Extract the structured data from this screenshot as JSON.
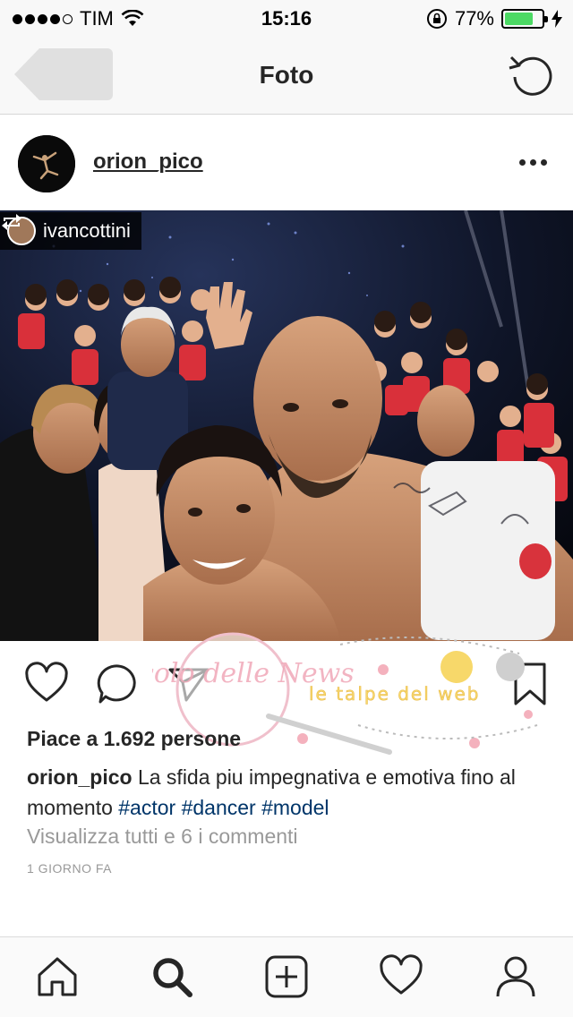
{
  "status_bar": {
    "carrier": "TIM",
    "time": "15:16",
    "battery_percent": "77%",
    "battery_level": 0.77,
    "signal_bars_filled": 4,
    "signal_bars_total": 5
  },
  "nav": {
    "title": "Foto",
    "back_icon": "back-arrow-icon",
    "refresh_icon": "refresh-icon"
  },
  "post": {
    "username": "orion_pico",
    "repost_username": "ivancottini",
    "likes": "Piace a 1.692 persone",
    "caption": {
      "user": "orion_pico",
      "text": "La sfida piu impegnativa e emotiva fino al momento",
      "tags": [
        "#actor",
        "#dancer",
        "#model"
      ]
    },
    "view_comments": "Visualizza tutti e 6 i commenti",
    "time": "1 GIORNO FA"
  },
  "watermark": {
    "stamp_text": "Vicolo delle News",
    "banner_text": "le talpe del web"
  },
  "tab_bar": {
    "items": [
      "home-icon",
      "search-icon",
      "add-icon",
      "activity-heart-icon",
      "profile-icon"
    ],
    "active": "search-icon"
  },
  "colors": {
    "hashtag": "#003569",
    "battery": "#4cd964",
    "text": "#262626",
    "muted": "#999999"
  }
}
